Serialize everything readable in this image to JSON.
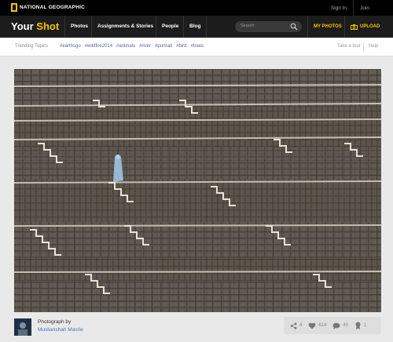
{
  "topbar": {
    "logo_text": "NATIONAL GEOGRAPHIC",
    "sign_in": "Sign In",
    "join": "Join"
  },
  "navbar": {
    "brand_your": "Your",
    "brand_shot": "Shot",
    "items": [
      "Photos",
      "Assignments & Stories",
      "People",
      "Blog"
    ],
    "search_placeholder": "Search",
    "my_photos": "MY PHOTOS",
    "upload": "UPLOAD"
  },
  "subbar": {
    "trending_label": "Trending Topics",
    "tags": [
      "#earthsgo",
      "#wildfire2014",
      "#animals",
      "#river",
      "#portrait",
      "#bird",
      "#trees"
    ],
    "take_tour": "Take a tour",
    "help": "Help"
  },
  "photo": {
    "alt": "Stepwell"
  },
  "footer": {
    "credit_label": "Photograph by",
    "photographer": "Muslianshah Masrie",
    "stats": {
      "shares": "4",
      "likes": "614",
      "comments": "40",
      "favorites": "1"
    }
  },
  "colors": {
    "accent": "#f5c400",
    "link": "#3f77b0"
  }
}
